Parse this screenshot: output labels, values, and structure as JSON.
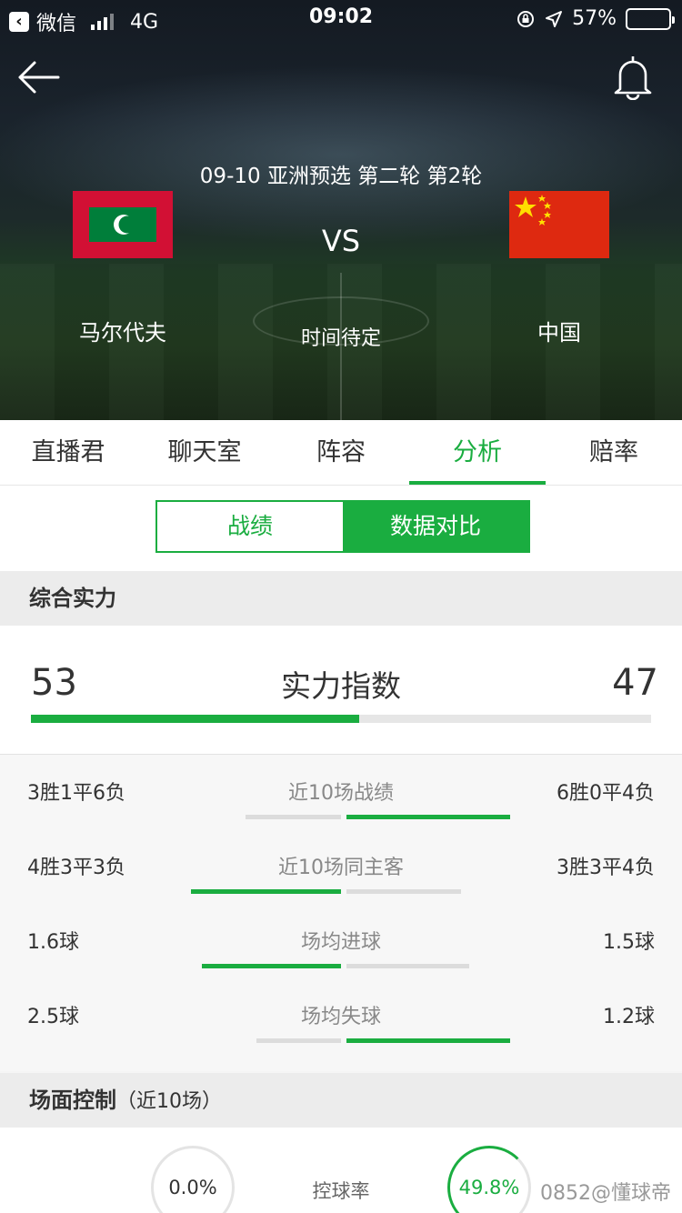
{
  "status": {
    "app": "微信",
    "network": "4G",
    "time": "09:02",
    "battery": "57%",
    "battery_level": 0.57
  },
  "match": {
    "info": "09-10   亚洲预选 第二轮 第2轮",
    "vs": "VS",
    "home_team": "马尔代夫",
    "away_team": "中国",
    "kickoff": "时间待定",
    "home_flag": "maldives-flag",
    "away_flag": "china-flag"
  },
  "tabs": [
    {
      "label": "直播君"
    },
    {
      "label": "聊天室"
    },
    {
      "label": "阵容"
    },
    {
      "label": "分析",
      "active": true
    },
    {
      "label": "赔率"
    }
  ],
  "subtabs": [
    {
      "label": "战绩"
    },
    {
      "label": "数据对比",
      "active": true
    }
  ],
  "section_strength": {
    "title": "综合实力",
    "index_label": "实力指数",
    "home_value": "53",
    "away_value": "47",
    "home_share": 0.53
  },
  "stats": [
    {
      "label": "近10场战绩",
      "home": "3胜1平6负",
      "away": "6胜0平4负",
      "home_bar": 0.35,
      "away_bar": 0.6,
      "home_green": false
    },
    {
      "label": "近10场同主客",
      "home": "4胜3平3负",
      "away": "3胜3平4负",
      "home_bar": 0.55,
      "away_bar": 0.42,
      "home_green": true
    },
    {
      "label": "场均进球",
      "home": "1.6球",
      "away": "1.5球",
      "home_bar": 0.51,
      "away_bar": 0.45,
      "home_green": true
    },
    {
      "label": "场均失球",
      "home": "2.5球",
      "away": "1.2球",
      "home_bar": 0.31,
      "away_bar": 0.6,
      "home_green": false
    }
  ],
  "section_control": {
    "title": "场面控制",
    "subtitle": "（近10场）",
    "possession_label": "控球率",
    "home_possession": "0.0%",
    "away_possession": "49.8%"
  },
  "watermark": "0852@懂球帝",
  "colors": {
    "accent": "#1aad40",
    "flag_red_maldives": "#d21034",
    "flag_green_maldives": "#007e3a",
    "flag_red_china": "#de2910",
    "flag_yellow_china": "#ffde00"
  }
}
